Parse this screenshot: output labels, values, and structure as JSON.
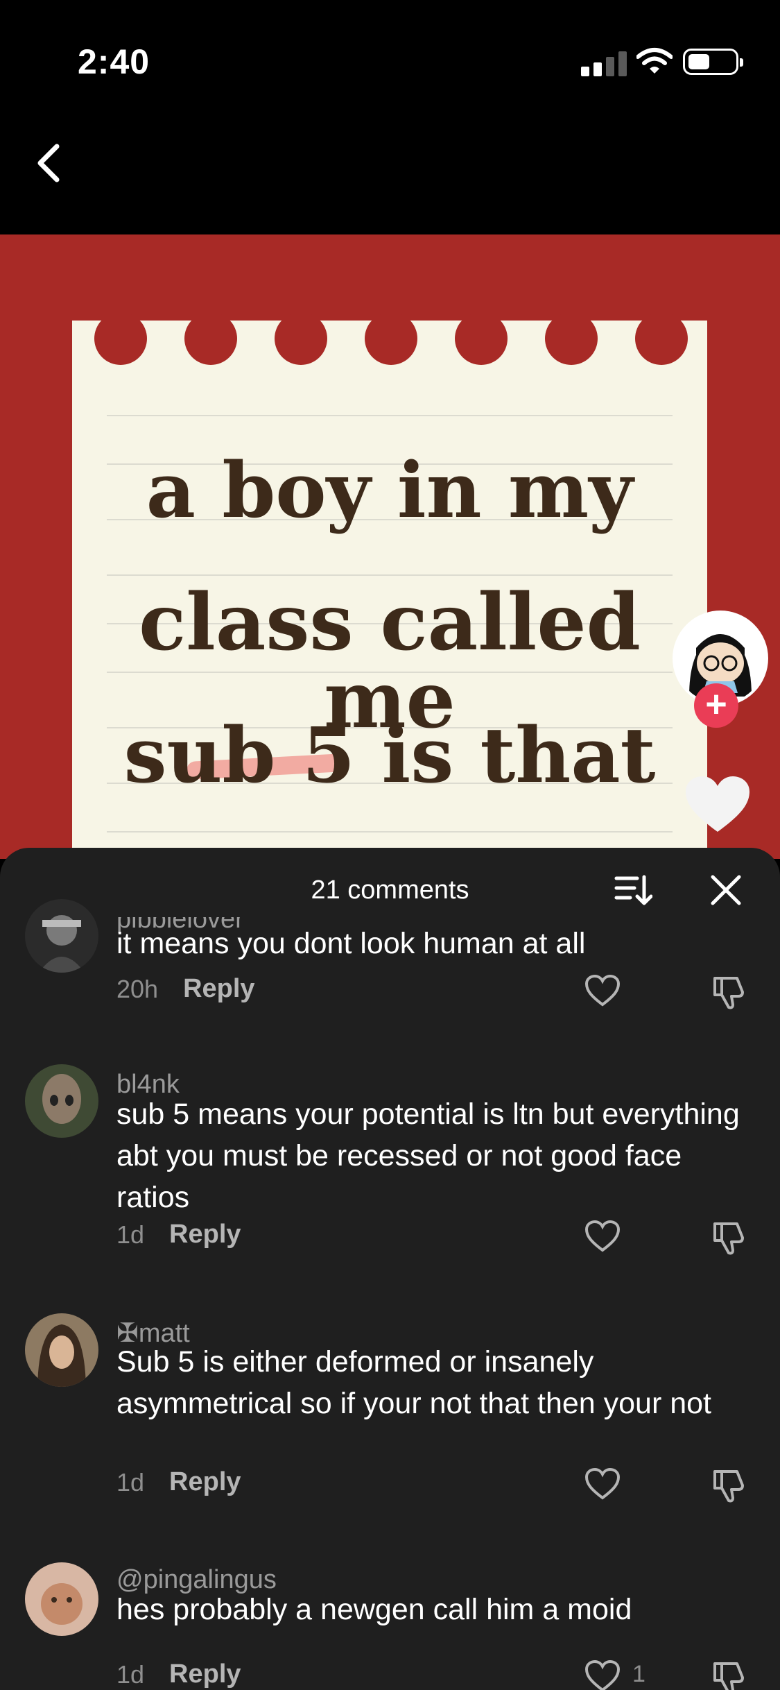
{
  "status_bar": {
    "time": "2:40"
  },
  "video": {
    "overlay_lines": [
      "a boy in my",
      "class called me",
      "sub 5 is that"
    ]
  },
  "sheet": {
    "title": "21 comments"
  },
  "comments": [
    {
      "username": "pibbielover",
      "body": "it means you dont look human at all",
      "time": "20h",
      "reply": "Reply",
      "likes": ""
    },
    {
      "username": "bl4nk",
      "body": "sub 5 means your potential is ltn but everything abt you must be recessed or not good face ratios",
      "time": "1d",
      "reply": "Reply",
      "likes": ""
    },
    {
      "username": "✠matt",
      "body": "Sub 5 is either deformed or insanely asymmetrical so if your not that then your not",
      "time": "1d",
      "reply": "Reply",
      "likes": ""
    },
    {
      "username": "@pingalingus",
      "body": "hes probably a newgen call him a moid",
      "time": "1d",
      "reply": "Reply",
      "likes": "1"
    }
  ]
}
